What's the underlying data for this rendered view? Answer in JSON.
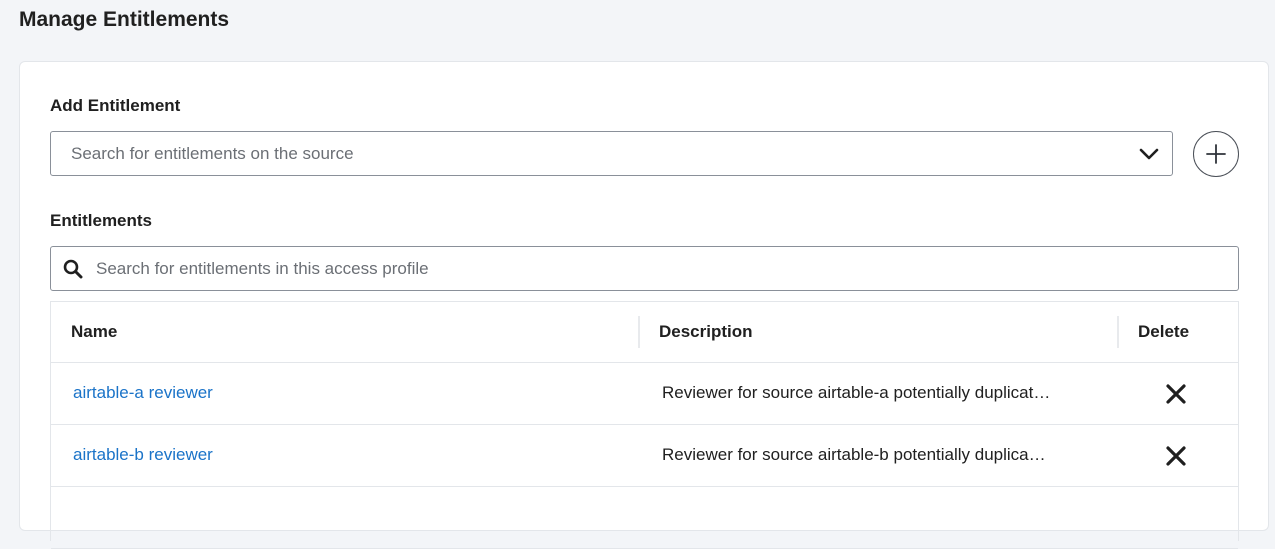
{
  "page": {
    "title": "Manage Entitlements"
  },
  "add_entitlement": {
    "label": "Add Entitlement",
    "placeholder": "Search for entitlements on the source",
    "dropdown_icon": "chevron-down-icon",
    "add_icon": "plus-circle-icon"
  },
  "entitlements": {
    "label": "Entitlements",
    "search_placeholder": "Search for entitlements in this access profile",
    "search_icon": "search-icon"
  },
  "table": {
    "columns": [
      "Name",
      "Description",
      "Delete"
    ],
    "rows": [
      {
        "name": "airtable-a reviewer",
        "description": "Reviewer for source airtable-a potentially duplicat…"
      },
      {
        "name": "airtable-b reviewer",
        "description": "Reviewer for source airtable-b potentially duplica…"
      }
    ]
  },
  "colors": {
    "link": "#1a73c8",
    "background": "#f3f5f8",
    "card": "#ffffff"
  }
}
